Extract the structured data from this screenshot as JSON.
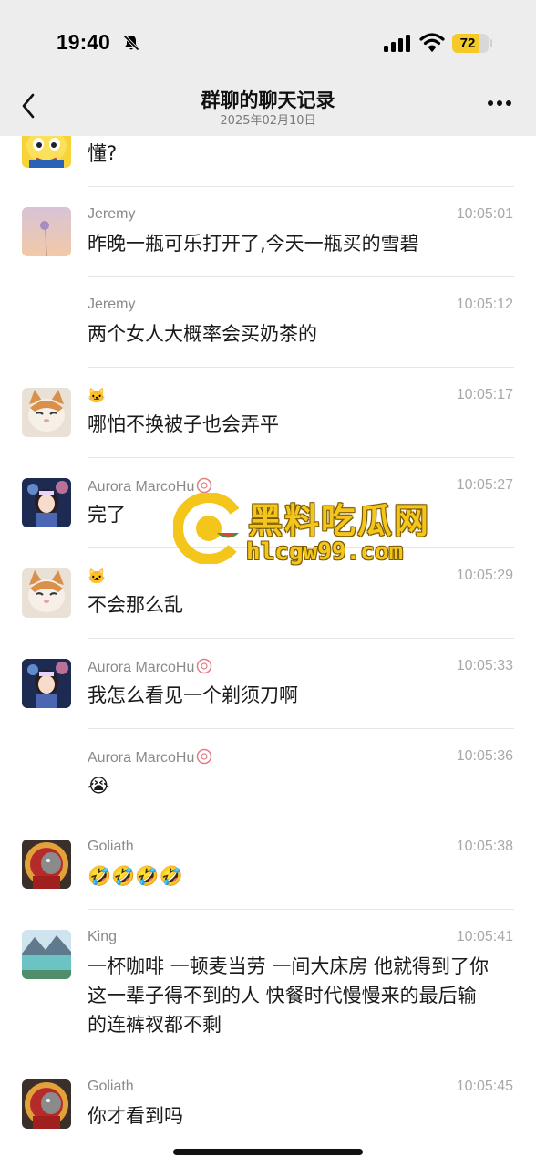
{
  "status_bar": {
    "time": "19:40",
    "battery": "72",
    "battery_level": 0.72
  },
  "header": {
    "title": "群聊的聊天记录",
    "subtitle": "2025年02月10日"
  },
  "messages": [
    {
      "sender": "",
      "time": "",
      "text": "懂?"
    },
    {
      "sender": "Jeremy",
      "time": "10:05:01",
      "text": "昨晚一瓶可乐打开了,今天一瓶买的雪碧"
    },
    {
      "sender": "Jeremy",
      "time": "10:05:12",
      "text": "两个女人大概率会买奶茶的"
    },
    {
      "sender": "🐱",
      "time": "10:05:17",
      "text": "哪怕不换被子也会弄平"
    },
    {
      "sender": "Aurora MarcoHu",
      "time": "10:05:27",
      "text": "完了"
    },
    {
      "sender": "🐱",
      "time": "10:05:29",
      "text": "不会那么乱"
    },
    {
      "sender": "Aurora MarcoHu",
      "time": "10:05:33",
      "text": "我怎么看见一个剃须刀啊"
    },
    {
      "sender": "Aurora MarcoHu",
      "time": "10:05:36",
      "text": "😭"
    },
    {
      "sender": "Goliath",
      "time": "10:05:38",
      "text": "🤣🤣🤣🤣"
    },
    {
      "sender": "King",
      "time": "10:05:41",
      "text_lines": [
        "一杯咖啡 一顿麦当劳 一间大床房 他就得到了你",
        "这一辈子得不到的人 快餐时代慢慢来的最后输",
        "的连裤衩都不剩"
      ]
    },
    {
      "sender": "Goliath",
      "time": "10:05:45",
      "text": "你才看到吗"
    }
  ],
  "watermark": {
    "name": "黑料吃瓜网",
    "url": "hlcgw99.com"
  },
  "icons": [
    "bell-slash-icon",
    "signal-icon",
    "wifi-icon",
    "battery-icon",
    "back-chevron-icon",
    "more-dots-icon",
    "flower-icon"
  ],
  "colors": {
    "header_bg": "#ededed",
    "battery_accent": "#f5c928",
    "watermark": "#f4c61b"
  }
}
